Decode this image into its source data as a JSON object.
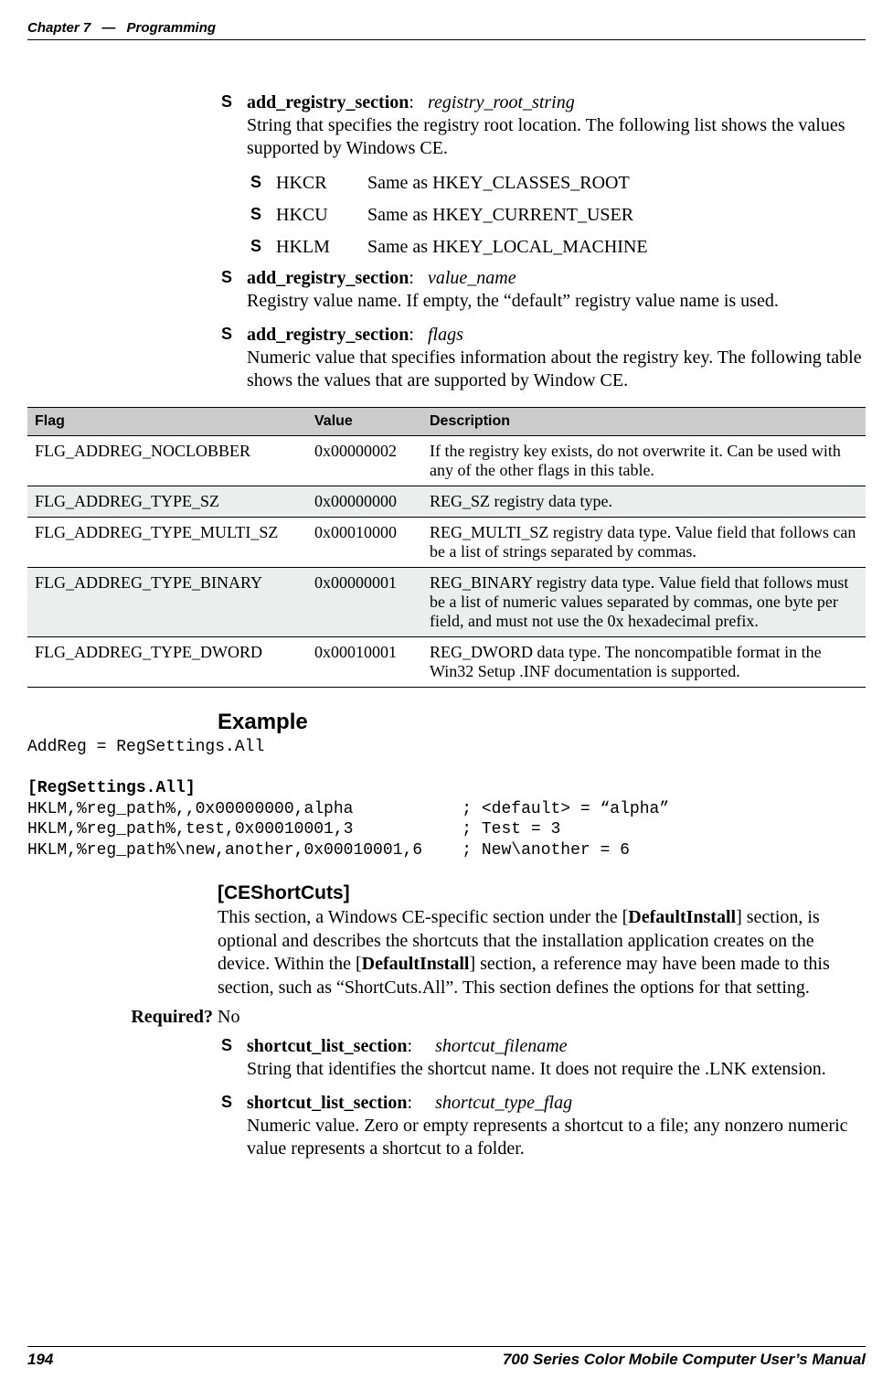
{
  "header": {
    "chapter": "Chapter 7",
    "sep": "—",
    "title": "Programming"
  },
  "bullets1": {
    "b1": {
      "term": "add_registry_section",
      "arg": "registry_root_string",
      "desc": "String that specifies the registry root location. The following list shows the values supported by Windows CE."
    },
    "subs": [
      {
        "abbr": "HKCR",
        "desc": "Same as HKEY_CLASSES_ROOT"
      },
      {
        "abbr": "HKCU",
        "desc": "Same as HKEY_CURRENT_USER"
      },
      {
        "abbr": "HKLM",
        "desc": "Same as HKEY_LOCAL_MACHINE"
      }
    ],
    "b2": {
      "term": "add_registry_section",
      "arg": "value_name",
      "desc": "Registry value name. If empty, the “default” registry value name is used."
    },
    "b3": {
      "term": "add_registry_section",
      "arg": "flags",
      "desc": "Numeric value that specifies information about the registry key. The following table shows the values that are supported by Window CE."
    }
  },
  "table": {
    "head": {
      "flag": "Flag",
      "value": "Value",
      "desc": "Description"
    },
    "rows": [
      {
        "flag": "FLG_ADDREG_NOCLOBBER",
        "value": "0x00000002",
        "desc": "If the registry key exists, do not overwrite it. Can be used with any of the other flags in this table."
      },
      {
        "flag": "FLG_ADDREG_TYPE_SZ",
        "value": "0x00000000",
        "desc": "REG_SZ registry data type."
      },
      {
        "flag": "FLG_ADDREG_TYPE_MULTI_SZ",
        "value": "0x00010000",
        "desc": "REG_MULTI_SZ registry data type. Value field that follows can be a list of strings separated by commas."
      },
      {
        "flag": "FLG_ADDREG_TYPE_BINARY",
        "value": "0x00000001",
        "desc": "REG_BINARY registry data type. Value field that follows must be a list of numeric values separated by commas, one byte per field, and must not use the 0x hexadecimal prefix."
      },
      {
        "flag": "FLG_ADDREG_TYPE_DWORD",
        "value": "0x00010001",
        "desc": "REG_DWORD data type. The noncompatible format in the Win32 Setup .INF documentation is supported."
      }
    ]
  },
  "example": {
    "heading": "Example",
    "line1": "AddReg = RegSettings.All",
    "section": "[RegSettings.All]",
    "l2": "HKLM,%reg_path%,,0x00000000,alpha           ; <default> = “alpha”",
    "l3": "HKLM,%reg_path%,test,0x00010001,3           ; Test = 3",
    "l4": "HKLM,%reg_path%\\new,another,0x00010001,6    ; New\\another = 6"
  },
  "ceshortcuts": {
    "heading": "[CEShortCuts]",
    "para_a": "This section, a Windows CE-specific section under the [",
    "para_b1": "DefaultInstall",
    "para_c": "] section, is optional and describes the shortcuts that the installation application creates on the device. Within the [",
    "para_b2": "DefaultInstall",
    "para_d": "] section, a reference may have been made to this section, such as “ShortCuts.All”. This section defines the options for that setting.",
    "required_label": "Required?",
    "required_val": "No",
    "b1": {
      "term": "shortcut_list_section",
      "arg": "shortcut_filename",
      "desc": "String that identifies the shortcut name. It does not require the .LNK extension."
    },
    "b2": {
      "term": "shortcut_list_section",
      "arg": "shortcut_type_flag",
      "desc": "Numeric value. Zero or empty represents a shortcut to a file; any nonzero numeric value represents a shortcut to a folder."
    }
  },
  "footer": {
    "page": "194",
    "title": "700 Series Color Mobile Computer User’s Manual"
  }
}
